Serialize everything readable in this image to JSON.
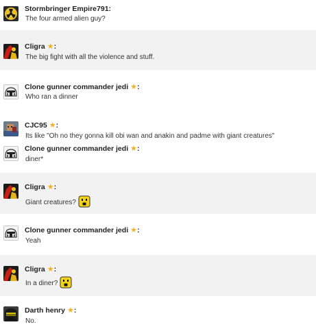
{
  "messages": [
    {
      "user": "Stormbringer Empire791",
      "star": false,
      "text": "The four armed alien guy?",
      "avatar": "hazard-avatar-icon",
      "smiley": false
    },
    {
      "user": "Cligra",
      "star": true,
      "text": "The big fight with all the violence and stuff.",
      "avatar": "red-figure-avatar-icon",
      "smiley": false
    },
    {
      "user": "Clone gunner commander jedi",
      "star": true,
      "text": "Who ran a dinner",
      "avatar": "clone-helmet-avatar-icon",
      "smiley": false
    },
    {
      "user": "CJC95",
      "star": true,
      "text": "Its like \"Oh no they gonna kill obi wan and anakin and padme with giant creatures\"",
      "avatar": "minifig-avatar-icon",
      "smiley": false
    },
    {
      "user": "Clone gunner commander jedi",
      "star": true,
      "text": "diner*",
      "avatar": "clone-helmet-avatar-icon",
      "smiley": false
    },
    {
      "user": "Cligra",
      "star": true,
      "text": "Giant creatures?",
      "avatar": "red-figure-avatar-icon",
      "smiley": true
    },
    {
      "user": "Clone gunner commander jedi",
      "star": true,
      "text": "Yeah",
      "avatar": "clone-helmet-avatar-icon",
      "smiley": false
    },
    {
      "user": "Cligra",
      "star": true,
      "text": "In a diner?",
      "avatar": "red-figure-avatar-icon",
      "smiley": true
    },
    {
      "user": "Darth henry",
      "star": true,
      "text": "No.",
      "avatar": "dark-helmet-avatar-icon",
      "smiley": false
    }
  ],
  "star_glyph": "★",
  "colon": ":",
  "colors": {
    "star": "#f2b01e",
    "shade": "#f2f2f2"
  }
}
